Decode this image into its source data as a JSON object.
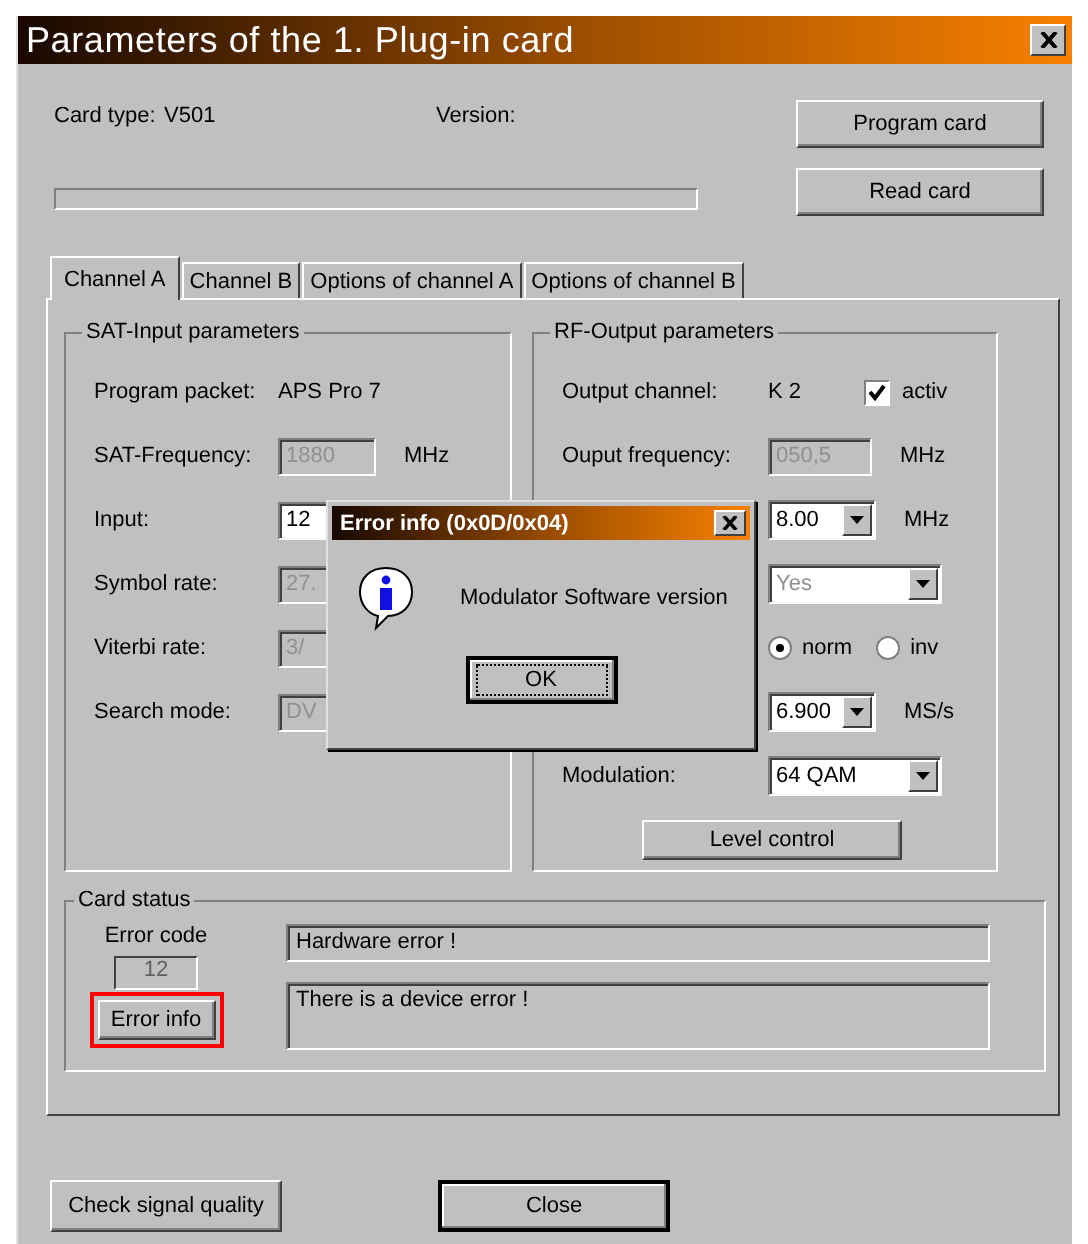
{
  "window": {
    "title": "Parameters of the 1. Plug-in card"
  },
  "card_info": {
    "card_type_label": "Card type:",
    "card_type": "V501",
    "version_label": "Version:"
  },
  "progress": {
    "level": 0
  },
  "top_buttons": [
    "Program card",
    "Read card"
  ],
  "tabs": [
    {
      "label": "Channel A",
      "selected": true
    },
    {
      "label": "Channel B",
      "selected": false
    },
    {
      "label": "Options of channel A",
      "selected": false
    },
    {
      "label": "Options of channel B",
      "selected": false
    }
  ],
  "sat_input": {
    "title": "SAT-Input parameters",
    "rows": [
      {
        "kind": "text",
        "label": "Program packet:",
        "value": "APS Pro 7"
      },
      {
        "kind": "field",
        "label": "SAT-Frequency:",
        "value": "1880",
        "disabled": true,
        "unit": "MHz"
      },
      {
        "kind": "field",
        "label": "Input:",
        "value": "12",
        "disabled": false
      },
      {
        "kind": "field",
        "label": "Symbol rate:",
        "value": "27.",
        "disabled": true
      },
      {
        "kind": "field",
        "label": "Viterbi rate:",
        "value": "3/",
        "disabled": true
      },
      {
        "kind": "field",
        "label": "Search mode:",
        "value": "DV",
        "disabled": true
      }
    ]
  },
  "rf_output": {
    "title": "RF-Output parameters",
    "rows": [
      {
        "kind": "text",
        "label": "Output channel:",
        "value": "K 2",
        "checkbox": {
          "label": "activ",
          "checked": true
        }
      },
      {
        "kind": "field",
        "label": "Ouput frequency:",
        "value": "050,5",
        "disabled": true,
        "unit": "MHz"
      },
      {
        "kind": "select",
        "value": "8.00",
        "unit": "MHz",
        "disabled": false,
        "wide": false
      },
      {
        "kind": "select",
        "value": "Yes",
        "disabled": true,
        "wide": true
      },
      {
        "kind": "radio",
        "options": [
          {
            "label": "norm",
            "selected": true
          },
          {
            "label": "inv",
            "selected": false
          }
        ]
      },
      {
        "kind": "select",
        "value": "6.900",
        "unit": "MS/s",
        "disabled": false,
        "wide": false
      },
      {
        "kind": "select",
        "label": "Modulation:",
        "value": "64 QAM",
        "disabled": false,
        "wide": true
      }
    ],
    "button": "Level control"
  },
  "card_status": {
    "title": "Card status",
    "error_code_label": "Error code",
    "error_code": "12",
    "error_info_button": "Error info",
    "highlighted": true,
    "message": "Hardware error !",
    "details": "There is a device error !"
  },
  "bottom_buttons": [
    {
      "label": "Check signal quality",
      "default": false
    },
    {
      "label": "Close",
      "default": true
    }
  ],
  "dialog": {
    "title": "Error info (0x0D/0x04)",
    "message": "Modulator Software version",
    "button": "OK"
  }
}
